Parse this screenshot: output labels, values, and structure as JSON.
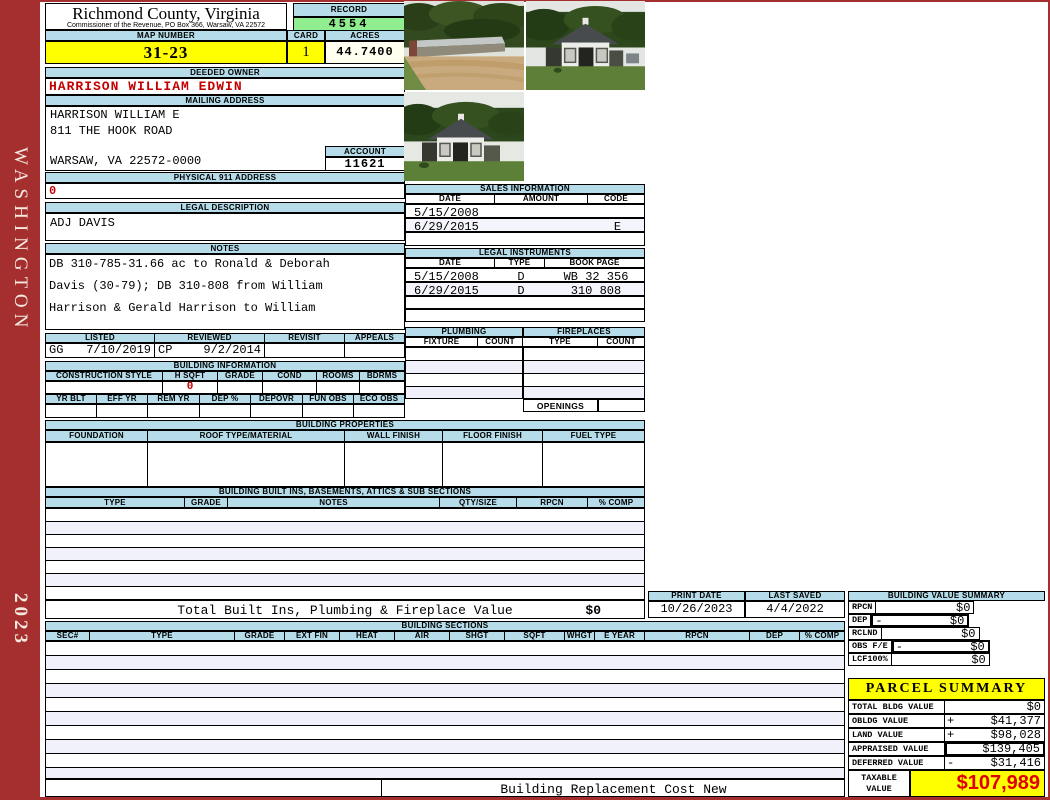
{
  "colors": {
    "header_blue": "#b5dce8",
    "record_green": "#90ee90",
    "highlight_yellow": "#ffff00",
    "acres_cream": "#fffff0",
    "sidebar_red": "#a52e2e",
    "alert_red": "#cc0000"
  },
  "sidebar": {
    "district": "WASHINGTON",
    "year": "2023"
  },
  "header": {
    "county": "Richmond County, Virginia",
    "commissioner": "Commissioner of the Revenue, PO Box 366, Warsaw, VA 22572",
    "record_label": "RECORD",
    "record": "4554",
    "map_label": "MAP NUMBER",
    "map": "31-23",
    "card_label": "CARD",
    "card": "1",
    "acres_label": "ACRES",
    "acres": "44.7400"
  },
  "owner": {
    "deeded_label": "DEEDED OWNER",
    "deeded": "HARRISON WILLIAM EDWIN",
    "mailing_label": "MAILING ADDRESS",
    "mailing_lines": [
      "HARRISON WILLIAM E",
      "811 THE HOOK ROAD",
      "WARSAW, VA 22572-0000"
    ],
    "account_label": "ACCOUNT",
    "account": "11621",
    "physical_label": "PHYSICAL 911 ADDRESS",
    "physical": "0",
    "legal_label": "LEGAL DESCRIPTION",
    "legal": "ADJ DAVIS",
    "notes_label": "NOTES",
    "notes_lines": [
      "DB 310-785-31.66 ac to Ronald & Deborah",
      "Davis (30-79); DB 310-808 from William",
      "Harrison & Gerald Harrison to William"
    ]
  },
  "visits": {
    "listed_label": "LISTED",
    "listed_by": "GG",
    "listed_date": "7/10/2019",
    "reviewed_label": "REVIEWED",
    "reviewed_by": "CP",
    "reviewed_date": "9/2/2014",
    "revisit_label": "REVISIT",
    "appeals_label": "APPEALS"
  },
  "building_info": {
    "title": "BUILDING INFORMATION",
    "row1_headers": [
      "CONSTRUCTION STYLE",
      "H SQFT",
      "GRADE",
      "COND",
      "ROOMS",
      "BDRMS"
    ],
    "h_sqft": "0",
    "row2_headers": [
      "YR BLT",
      "EFF YR",
      "REM YR",
      "DEP %",
      "DEPOVR",
      "FUN OBS",
      "ECO OBS"
    ]
  },
  "building_properties": {
    "title": "BUILDING PROPERTIES",
    "headers": [
      "FOUNDATION",
      "ROOF TYPE/MATERIAL",
      "WALL FINISH",
      "FLOOR FINISH",
      "FUEL TYPE"
    ]
  },
  "built_ins": {
    "title": "BUILDING BUILT INS, BASEMENTS, ATTICS & SUB SECTIONS",
    "headers": [
      "TYPE",
      "GRADE",
      "NOTES",
      "QTY/SIZE",
      "RPCN",
      "% COMP"
    ],
    "total_label": "Total Built Ins, Plumbing & Fireplace Value",
    "total_value": "$0"
  },
  "sales": {
    "title": "SALES INFORMATION",
    "headers": [
      "DATE",
      "AMOUNT",
      "CODE"
    ],
    "rows": [
      [
        "5/15/2008",
        "",
        ""
      ],
      [
        "6/29/2015",
        "",
        "E"
      ],
      [
        "",
        "",
        ""
      ]
    ]
  },
  "instruments": {
    "title": "LEGAL INSTRUMENTS",
    "headers": [
      "DATE",
      "TYPE",
      "BOOK PAGE"
    ],
    "rows": [
      [
        "5/15/2008",
        "D",
        "WB 32 356"
      ],
      [
        "6/29/2015",
        "D",
        "310 808"
      ],
      [
        "",
        "",
        ""
      ],
      [
        "",
        "",
        ""
      ]
    ]
  },
  "plumbing": {
    "title": "PLUMBING",
    "headers": [
      "FIXTURE",
      "COUNT"
    ]
  },
  "fireplaces": {
    "title": "FIREPLACES",
    "headers": [
      "TYPE",
      "COUNT"
    ],
    "openings_label": "OPENINGS"
  },
  "dates": {
    "print_label": "PRINT DATE",
    "print_date": "10/26/2023",
    "saved_label": "LAST SAVED",
    "saved_date": "4/4/2022"
  },
  "building_value_summary": {
    "title": "BUILDING VALUE SUMMARY",
    "rows": [
      {
        "label": "RPCN",
        "extra": "",
        "op": "",
        "value": "$0"
      },
      {
        "label": "DEP",
        "extra": "",
        "op": "-",
        "value": "$0"
      },
      {
        "label": "RCLND",
        "extra": "",
        "op": "",
        "value": "$0"
      },
      {
        "label": "OBS F/E",
        "extra": "",
        "op": "-",
        "value": "$0"
      },
      {
        "label": "LCF",
        "extra": "100%",
        "op": "",
        "value": "$0"
      }
    ]
  },
  "building_sections": {
    "title": "BUILDING SECTIONS",
    "headers": [
      "SEC#",
      "TYPE",
      "GRADE",
      "EXT FIN",
      "HEAT",
      "AIR",
      "SHGT",
      "SQFT",
      "WHGT",
      "E YEAR",
      "RPCN",
      "DEP",
      "% COMP"
    ],
    "footer": "Building Replacement Cost New"
  },
  "parcel_summary": {
    "title": "PARCEL SUMMARY",
    "rows": [
      {
        "label": "TOTAL BLDG VALUE",
        "op": "",
        "value": "$0"
      },
      {
        "label": "OBLDG VALUE",
        "op": "+",
        "value": "$41,377"
      },
      {
        "label": "LAND VALUE",
        "op": "+",
        "value": "$98,028"
      },
      {
        "label": "APPRAISED VALUE",
        "op": "",
        "value": "$139,405"
      },
      {
        "label": "DEFERRED VALUE",
        "op": "-",
        "value": "$31,416"
      }
    ],
    "taxable_label": "TAXABLE VALUE",
    "taxable_value": "$107,989"
  },
  "photos": {
    "photo1_alt": "farm-building-photo-1",
    "photo2_alt": "farm-building-photo-2",
    "photo3_alt": "farm-building-photo-3"
  }
}
